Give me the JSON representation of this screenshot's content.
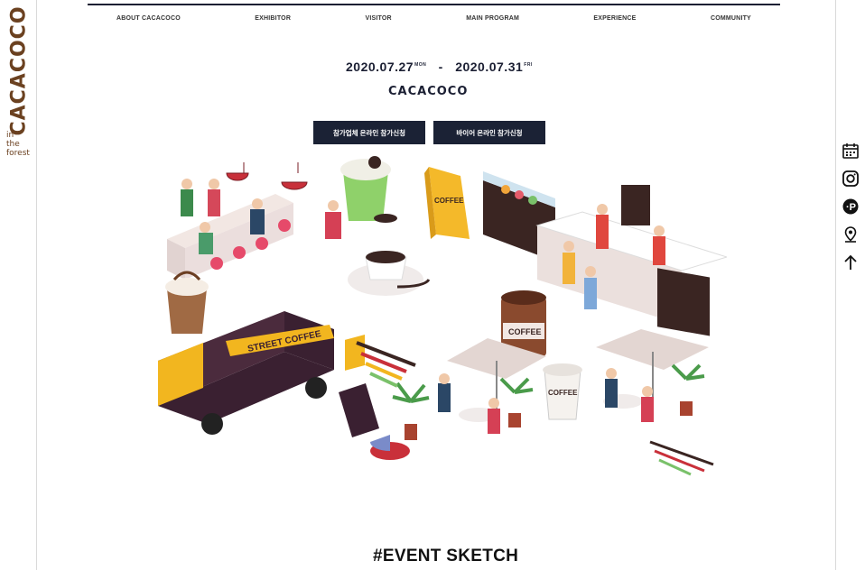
{
  "brand": {
    "vertical_logo": "CACACOCO",
    "tagline_lines": [
      "in",
      "the",
      "forest"
    ],
    "brand_color": "#6b4120"
  },
  "nav": {
    "items": [
      "ABOUT CACACOCO",
      "EXHIBITOR",
      "VISITOR",
      "MAIN PROGRAM",
      "EXPERIENCE",
      "COMMUNITY"
    ]
  },
  "hero": {
    "date_start": "2020.07.27",
    "date_start_day": "MON",
    "dash": "-",
    "date_end": "2020.07.31",
    "date_end_day": "FRI",
    "logo_text": "CACACOCO",
    "button_exhibitor": "참가업체 온라인 참가신청",
    "button_buyer": "바이어 온라인 참가신청",
    "button_color": "#1b2235"
  },
  "illustration": {
    "truck_sign": "STREET COFFEE",
    "cup_label": "COFFEE",
    "can_label": "COFFEE",
    "bag_label": "COFFEE"
  },
  "section": {
    "title": "#EVENT SKETCH"
  },
  "side_tools": {
    "icons": [
      "calendar-icon",
      "instagram-icon",
      "naver-post-icon",
      "location-icon",
      "scroll-top-icon"
    ]
  }
}
